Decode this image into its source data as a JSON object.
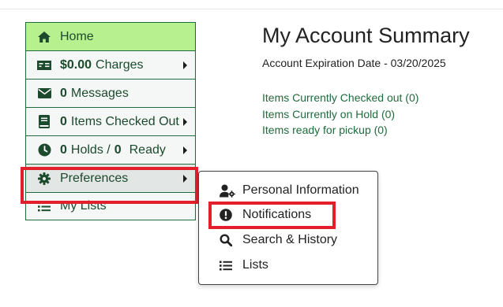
{
  "sidebar": {
    "items": [
      {
        "icon": "home-icon",
        "label": "Home"
      },
      {
        "icon": "charges-icon",
        "number": "$0.00",
        "label": "Charges",
        "has_caret": true
      },
      {
        "icon": "envelope-icon",
        "number": "0",
        "label": "Messages"
      },
      {
        "icon": "book-icon",
        "number": "0",
        "label": "Items Checked Out",
        "has_caret": true
      },
      {
        "icon": "clock-icon",
        "number": "0",
        "label": "Holds /",
        "number2": "0",
        "label2": "Ready",
        "has_caret": true
      },
      {
        "icon": "gear-icon",
        "label": "Preferences",
        "has_caret": true
      },
      {
        "icon": "list-icon",
        "label": "My Lists"
      }
    ]
  },
  "main": {
    "title": "My Account Summary",
    "expiration": "Account Expiration Date - 03/20/2025",
    "links": [
      "Items Currently Checked out (0)",
      "Items Currently on Hold (0)",
      "Items ready for pickup (0)"
    ]
  },
  "preferences_menu": {
    "items": [
      {
        "icon": "user-gear-icon",
        "label": "Personal Information"
      },
      {
        "icon": "exclamation-circle-icon",
        "label": "Notifications"
      },
      {
        "icon": "search-icon",
        "label": "Search & History"
      },
      {
        "icon": "list-icon",
        "label": "Lists"
      }
    ]
  },
  "colors": {
    "accent": "#1f6b3c",
    "home_bg": "#b7f18f",
    "highlight": "#e21f2a",
    "link": "#1f6b3c"
  }
}
